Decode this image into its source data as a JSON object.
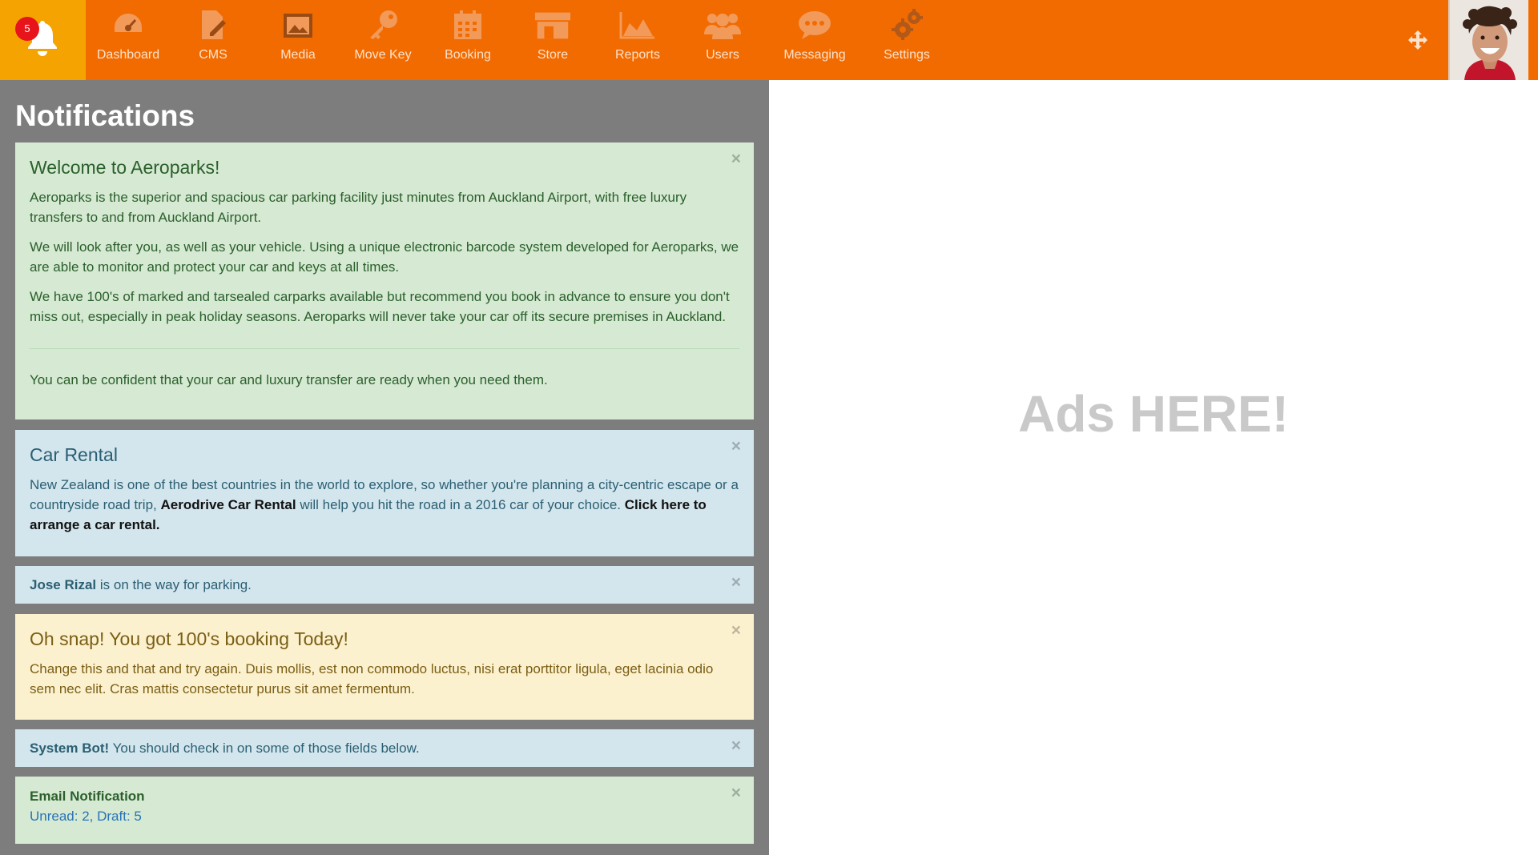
{
  "topbar": {
    "notification_count": "5",
    "brand_color": "#f26b00",
    "bell_bg": "#f5a300",
    "nav": [
      {
        "label": "Dashboard",
        "icon": "dashboard-gauge-icon"
      },
      {
        "label": "CMS",
        "icon": "cms-document-edit-icon"
      },
      {
        "label": "Media",
        "icon": "media-image-icon"
      },
      {
        "label": "Move Key",
        "icon": "key-icon"
      },
      {
        "label": "Booking",
        "icon": "calendar-icon"
      },
      {
        "label": "Store",
        "icon": "store-icon"
      },
      {
        "label": "Reports",
        "icon": "area-chart-icon"
      },
      {
        "label": "Users",
        "icon": "users-icon"
      },
      {
        "label": "Messaging",
        "icon": "chat-bubbles-icon"
      },
      {
        "label": "Settings",
        "icon": "gears-icon"
      }
    ]
  },
  "notifications": {
    "title": "Notifications",
    "welcome": {
      "heading": "Welcome to Aeroparks!",
      "p1": "Aeroparks is the superior and spacious car parking facility just minutes from Auckland Airport, with free luxury transfers to and from Auckland Airport.",
      "p2": "We will look after you, as well as your vehicle. Using a unique electronic barcode system developed for Aeroparks, we are able to monitor and protect your car and keys at all times.",
      "p3": "We have 100's of marked and tarsealed carparks available but recommend you book in advance to ensure you don't miss out, especially in peak holiday seasons. Aeroparks will never take your car off its secure premises in Auckland.",
      "p4": "You can be confident that your car and luxury transfer are ready when you need them."
    },
    "rental": {
      "heading": "Car Rental",
      "text_a": "New Zealand is one of the best countries in the world to explore, so whether you're planning a city-centric escape or a countryside road trip,",
      "brand": "Aerodrive Car Rental",
      "text_b": "will help you hit the road in a 2016 car of your choice.",
      "link": "Click here to arrange a car rental."
    },
    "parking": {
      "name": "Jose Rizal",
      "text": "is on the way for parking."
    },
    "booking": {
      "heading": "Oh snap! You got 100's booking Today!",
      "text": "Change this and that and try again. Duis mollis, est non commodo luctus, nisi erat porttitor ligula, eget lacinia odio sem nec elit. Cras mattis consectetur purus sit amet fermentum."
    },
    "bot": {
      "name": "System Bot!",
      "text": "You should check in on some of those fields below."
    },
    "email": {
      "title": "Email Notification",
      "value": "Unread: 2, Draft: 5"
    },
    "close_glyph": "×"
  },
  "ads": {
    "text": "Ads HERE!"
  }
}
